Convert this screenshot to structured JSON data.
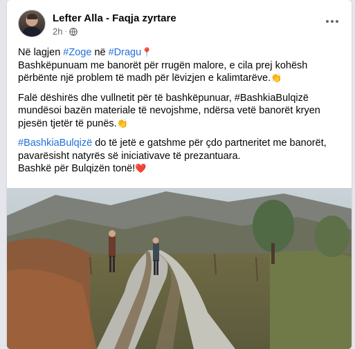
{
  "post": {
    "author": "Lefter Alla - Faqja zyrtare",
    "time": "2h",
    "separator": "·",
    "privacy_icon": "globe-icon",
    "more_icon": "more-horizontal-icon"
  },
  "content": {
    "p1_prefix": "Në lagjen ",
    "p1_tag1": "#Zoge",
    "p1_mid": " në ",
    "p1_tag2": "#Dragu",
    "p1_emoji": "📍",
    "p1_line2": "Bashkëpunuam me banorët për rrugën malore, e cila prej kohësh përbënte një problem të madh për lëvizjen e kalimtarëve.",
    "p1_emoji2": "👏",
    "p2_text": "Falë dëshirës dhe vullnetit për të bashkëpunuar, #BashkiaBulqizë mundësoi bazën materiale të nevojshme, ndërsa vetë banorët kryen pjesën tjetër të punës.",
    "p2_emoji": "👏",
    "p3_tag": "#BashkiaBulqizë",
    "p3_text": " do të jetë e gatshme për çdo partneritet me banorët, pavarësisht natyrës së iniciativave të prezantuara.",
    "p3_line2": "Bashkë për Bulqizën tonë!",
    "p3_emoji": "❤️"
  },
  "colors": {
    "link": "#216fdb",
    "text": "#050505",
    "secondary": "#65676b"
  }
}
